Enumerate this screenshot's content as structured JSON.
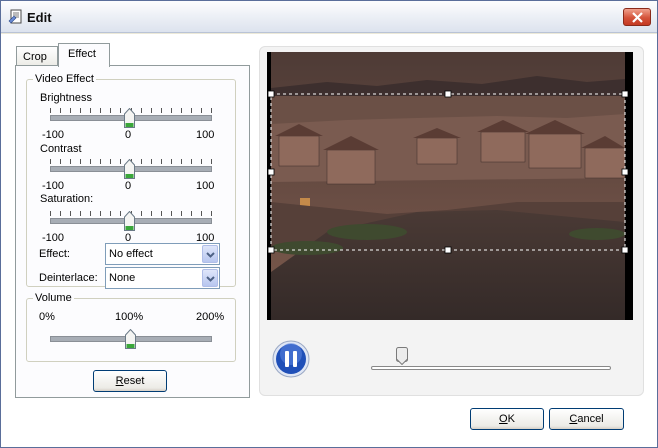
{
  "window": {
    "title": "Edit"
  },
  "tabs": [
    {
      "label": "Crop",
      "active": false
    },
    {
      "label": "Effect",
      "active": true
    }
  ],
  "video_effect": {
    "legend": "Video Effect",
    "brightness": {
      "label": "Brightness",
      "min": "-100",
      "mid": "0",
      "max": "100",
      "value": 0
    },
    "contrast": {
      "label": "Contrast",
      "min": "-100",
      "mid": "0",
      "max": "100",
      "value": 0
    },
    "saturation": {
      "label": "Saturation:",
      "min": "-100",
      "mid": "0",
      "max": "100",
      "value": 0
    },
    "effect": {
      "label": "Effect:",
      "selected": "No effect"
    },
    "deinterlace": {
      "label": "Deinterlace:",
      "selected": "None"
    }
  },
  "volume": {
    "legend": "Volume",
    "min": "0%",
    "mid": "100%",
    "max": "200%",
    "value_percent": 100
  },
  "buttons": {
    "reset": "Reset",
    "ok": "OK",
    "cancel": "Cancel"
  },
  "player": {
    "state": "playing",
    "seek_position_fraction": 0.13
  },
  "colors": {
    "accent_blue": "#1f4fb8",
    "thumb_green": "#3aa63a",
    "close_red": "#c43a22"
  }
}
